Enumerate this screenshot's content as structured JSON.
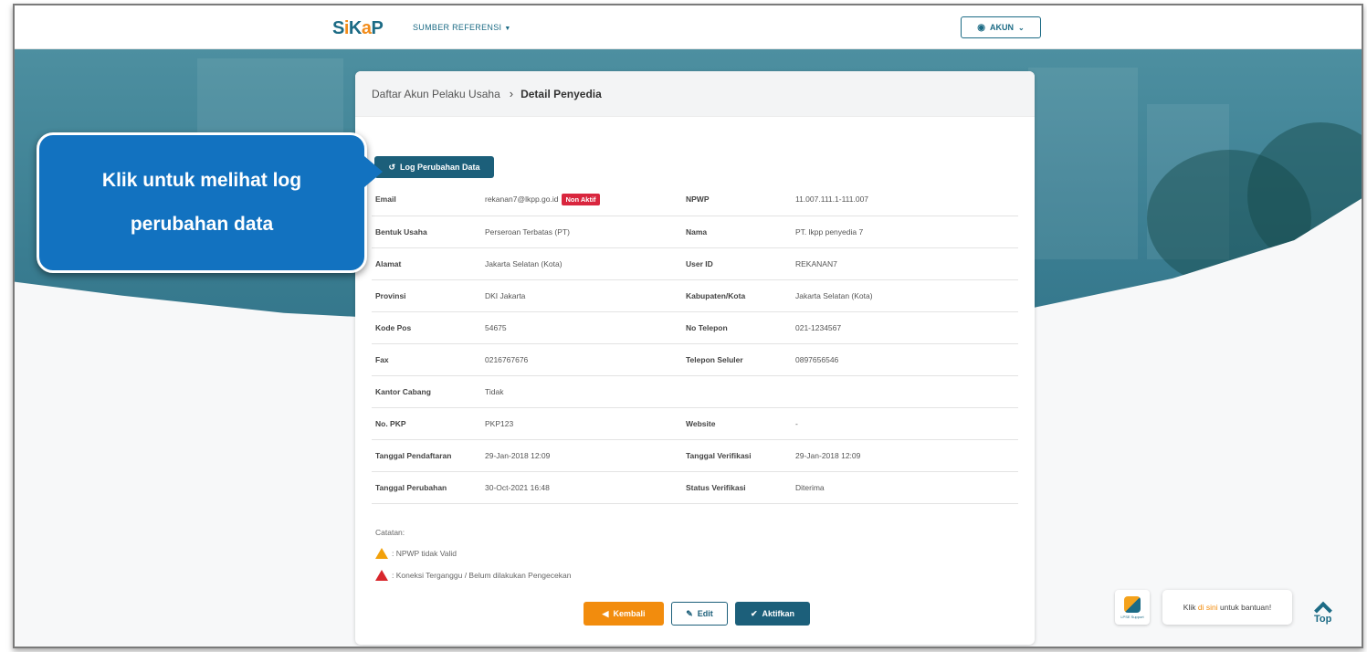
{
  "header": {
    "logo_s": "S",
    "logo_i": "i",
    "logo_k": "K",
    "logo_a": "a",
    "logo_p": "P",
    "nav_ref": "SUMBER REFERENSI",
    "akun": "AKUN"
  },
  "breadcrumb": {
    "parent": "Daftar Akun Pelaku Usaha",
    "separator": "›",
    "current": "Detail Penyedia"
  },
  "log_button": "Log Perubahan Data",
  "details": {
    "rows": [
      {
        "l1": "Email",
        "v1": "rekanan7@lkpp.go.id",
        "badge": "Non Aktif",
        "l2": "NPWP",
        "v2": "11.007.111.1-111.007"
      },
      {
        "l1": "Bentuk Usaha",
        "v1": "Perseroan Terbatas (PT)",
        "l2": "Nama",
        "v2": "PT. lkpp penyedia 7"
      },
      {
        "l1": "Alamat",
        "v1": "Jakarta Selatan (Kota)",
        "l2": "User ID",
        "v2": "REKANAN7"
      },
      {
        "l1": "Provinsi",
        "v1": "DKI Jakarta",
        "l2": "Kabupaten/Kota",
        "v2": "Jakarta Selatan (Kota)"
      },
      {
        "l1": "Kode Pos",
        "v1": "54675",
        "l2": "No Telepon",
        "v2": "021-1234567"
      },
      {
        "l1": "Fax",
        "v1": "0216767676",
        "l2": "Telepon Seluler",
        "v2": "0897656546"
      },
      {
        "l1": "Kantor Cabang",
        "v1": "Tidak",
        "l2": "",
        "v2": ""
      },
      {
        "l1": "No. PKP",
        "v1": "PKP123",
        "l2": "Website",
        "v2": "-"
      },
      {
        "l1": "Tanggal Pendaftaran",
        "v1": "29-Jan-2018 12:09",
        "l2": "Tanggal Verifikasi",
        "v2": "29-Jan-2018 12:09"
      },
      {
        "l1": "Tanggal Perubahan",
        "v1": "30-Oct-2021 16:48",
        "l2": "Status Verifikasi",
        "v2": "Diterima"
      }
    ]
  },
  "notes": {
    "title": "Catatan:",
    "warn1": ": NPWP tidak Valid",
    "warn2": ": Koneksi Terganggu / Belum dilakukan Pengecekan"
  },
  "actions": {
    "kembali": "Kembali",
    "edit": "Edit",
    "aktifkan": "Aktifkan"
  },
  "callout": {
    "line1": "Klik untuk melihat log",
    "line2": "perubahan data"
  },
  "help": {
    "logo_caption": "LPSE Support",
    "text_pre": "Klik",
    "text_link": "di sini",
    "text_post": "untuk bantuan!"
  },
  "top": "Top",
  "colors": {
    "primary": "#1c5f7a",
    "accent": "#f28c0d",
    "danger": "#d9263e",
    "callout": "#1272c0"
  }
}
